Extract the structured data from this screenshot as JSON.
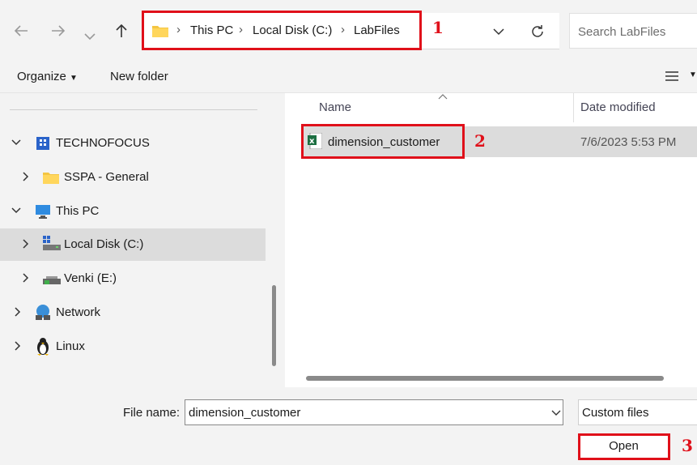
{
  "nav": {
    "back_icon": "arrow-left-icon",
    "forward_icon": "arrow-right-icon",
    "recent_icon": "chevron-down-icon",
    "up_icon": "arrow-up-icon"
  },
  "address": {
    "folder_icon": "folder-icon",
    "crumbs": [
      "This PC",
      "Local Disk (C:)",
      "LabFiles"
    ],
    "separator": "›",
    "dropdown_icon": "chevron-down-icon",
    "refresh_icon": "refresh-icon"
  },
  "search": {
    "placeholder": "Search LabFiles"
  },
  "toolbar": {
    "organize": "Organize",
    "new_folder": "New folder",
    "view_icon": "list-view-icon"
  },
  "sidebar": {
    "items": [
      {
        "label": "TECHNOFOCUS",
        "icon": "building-icon",
        "expanded": true
      },
      {
        "label": "SSPA - General",
        "icon": "folder-icon",
        "expanded": false
      },
      {
        "label": "This PC",
        "icon": "monitor-icon",
        "expanded": true
      },
      {
        "label": "Local Disk (C:)",
        "icon": "drive-icon",
        "expanded": false,
        "selected": true
      },
      {
        "label": "Venki (E:)",
        "icon": "usb-drive-icon",
        "expanded": false
      },
      {
        "label": "Network",
        "icon": "network-icon",
        "expanded": false
      },
      {
        "label": "Linux",
        "icon": "penguin-icon",
        "expanded": false
      }
    ]
  },
  "filelist": {
    "columns": [
      "Name",
      "Date modified"
    ],
    "files": [
      {
        "name": "dimension_customer",
        "modified": "7/6/2023 5:53 PM",
        "icon": "excel-file-icon"
      }
    ]
  },
  "footer": {
    "file_name_label": "File name:",
    "file_name_value": "dimension_customer",
    "filter_value": "Custom files",
    "open_label": "Open"
  },
  "annotations": [
    "1",
    "2",
    "3"
  ],
  "colors": {
    "annotation": "#e0101a",
    "selection": "#dcdcdc",
    "excel_green": "#1d6f42"
  }
}
